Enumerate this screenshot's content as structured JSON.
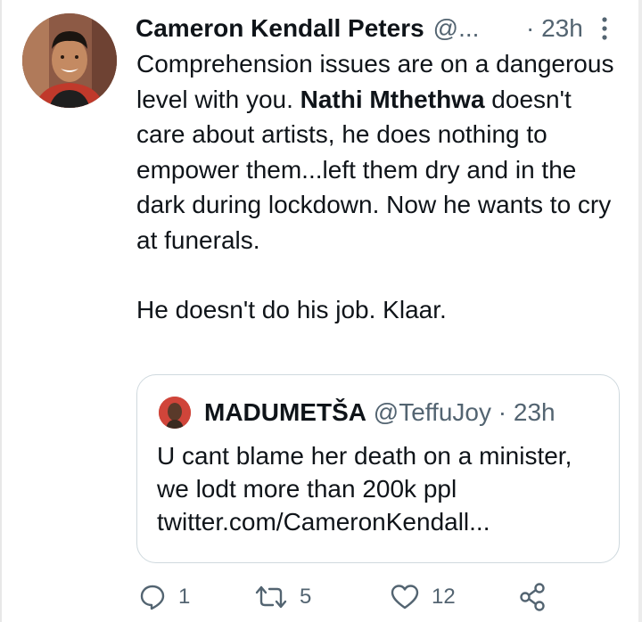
{
  "tweet": {
    "author_name": "Cameron Kendall Peters",
    "author_handle": "@...",
    "time": "· 23h",
    "text_parts": {
      "line_a": "Comprehension issues are on a dangerous level with you. ",
      "mention": "Nathi Mthethwa",
      "line_b": " doesn't care about artists, he does nothing to empower them...left them dry and in the dark during lockdown. Now he wants to cry at funerals.",
      "para2": "He doesn't do his job. Klaar."
    }
  },
  "quote": {
    "name": "MADUMETŠA",
    "handle": "@TeffuJoy",
    "time": "· 23h",
    "text": "U cant blame her death on a minister, we lodt more than 200k ppl twitter.com/CameronKendall..."
  },
  "actions": {
    "reply_count": "1",
    "retweet_count": "5",
    "like_count": "12"
  },
  "icons": {
    "reply": "reply-icon",
    "retweet": "retweet-icon",
    "like": "heart-icon",
    "share": "share-icon",
    "more": "more-vertical-icon"
  },
  "colors": {
    "text": "#0f1419",
    "secondary": "#536471",
    "border": "#cfd9de"
  }
}
